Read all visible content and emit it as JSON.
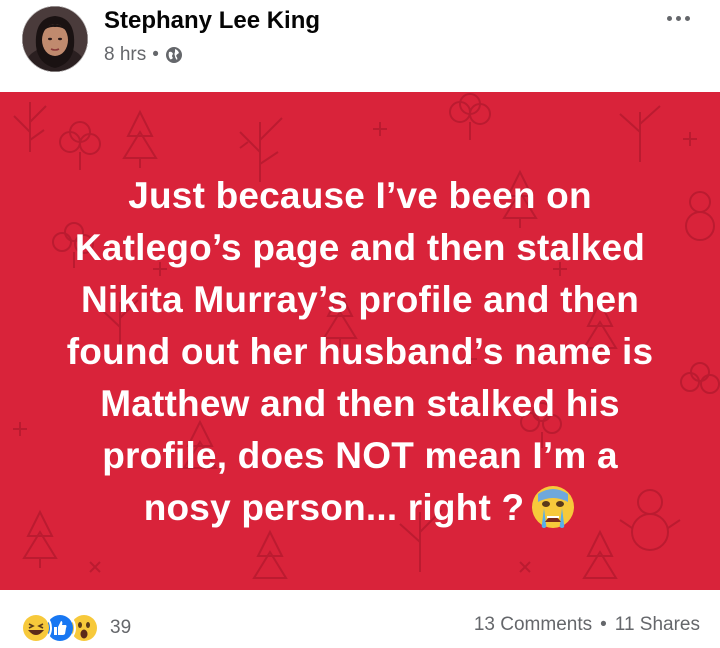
{
  "post": {
    "author_name": "Stephany Lee King",
    "timestamp": "8 hrs",
    "separator": "•",
    "privacy_icon": "globe-icon",
    "more_icon": "more-options-icon",
    "text_lines": [
      "Just because I’ve been on",
      "Katlego’s page and then stalked",
      "Nikita Murray’s profile and then",
      "found out her husband’s name is",
      "Matthew and then stalked his",
      "profile, does NOT mean I’m a",
      "nosy person... right ?"
    ],
    "emoji": "crying-face-emoji",
    "background_color": "#d9233a"
  },
  "footer": {
    "reaction_icons": [
      "haha-icon",
      "like-icon",
      "wow-icon"
    ],
    "reaction_count": "39",
    "comments": "13 Comments",
    "dot": "•",
    "shares": "11 Shares"
  }
}
